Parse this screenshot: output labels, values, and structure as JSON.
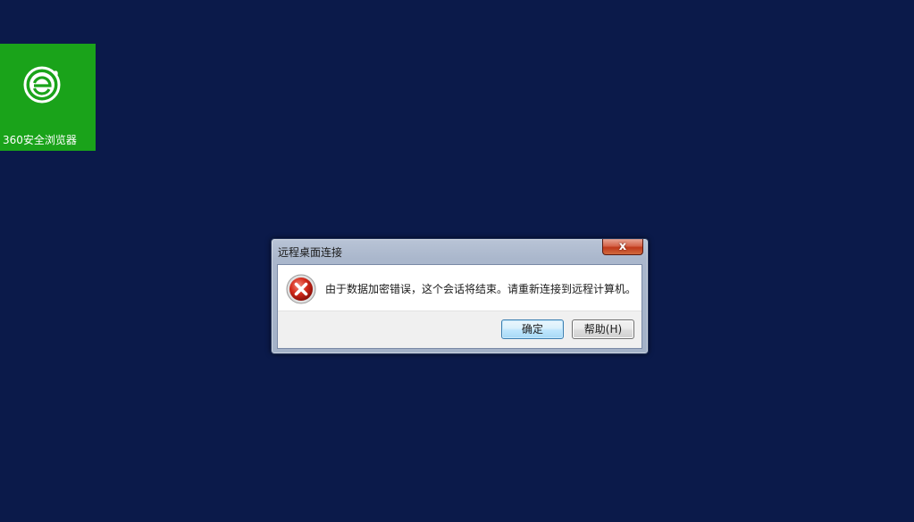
{
  "desktop": {
    "background_color": "#0b1a4a",
    "tile": {
      "label": "360安全浏览器",
      "color": "#1aa31a",
      "icon": "browser-e-icon"
    }
  },
  "dialog": {
    "title": "远程桌面连接",
    "close_symbol": "x",
    "icon": "error-icon",
    "message": "由于数据加密错误，这个会话将结束。请重新连接到远程计算机。",
    "buttons": {
      "ok_label": "确定",
      "help_label": "帮助(H)"
    }
  }
}
